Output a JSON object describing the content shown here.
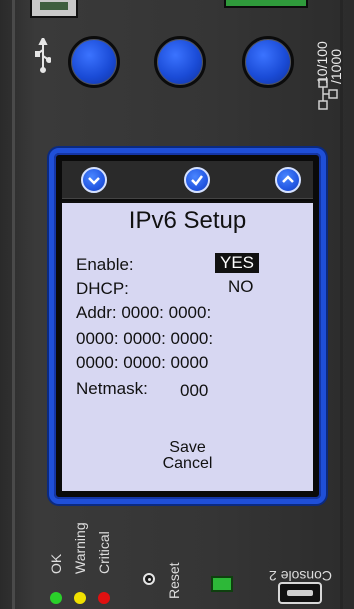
{
  "screen": {
    "title": "IPv6 Setup",
    "enable_label": "Enable:",
    "enable_value": "YES",
    "dhcp_label": "DHCP:",
    "dhcp_value": "NO",
    "addr_line1": "Addr: 0000: 0000:",
    "addr_line2": "0000: 0000: 0000:",
    "addr_line3": "0000: 0000: 0000",
    "netmask_label": "Netmask:",
    "netmask_value": "000",
    "save_label": "Save",
    "cancel_label": "Cancel"
  },
  "device_labels": {
    "speed_line1": "10/100",
    "speed_line2": "/1000",
    "ok": "OK",
    "warning": "Warning",
    "critical": "Critical",
    "reset": "Reset",
    "console": "Console 2"
  },
  "colors": {
    "accent_blue": "#2459E4",
    "screen_bg": "#D7D7F2",
    "led_ok": "#2AD02A",
    "led_warning": "#F0E000",
    "led_critical": "#E01010"
  },
  "icons": {
    "usb": "usb-icon",
    "network": "ethernet-icon",
    "nav": [
      "chevron-down-icon",
      "checkmark-icon",
      "chevron-up-icon"
    ]
  }
}
